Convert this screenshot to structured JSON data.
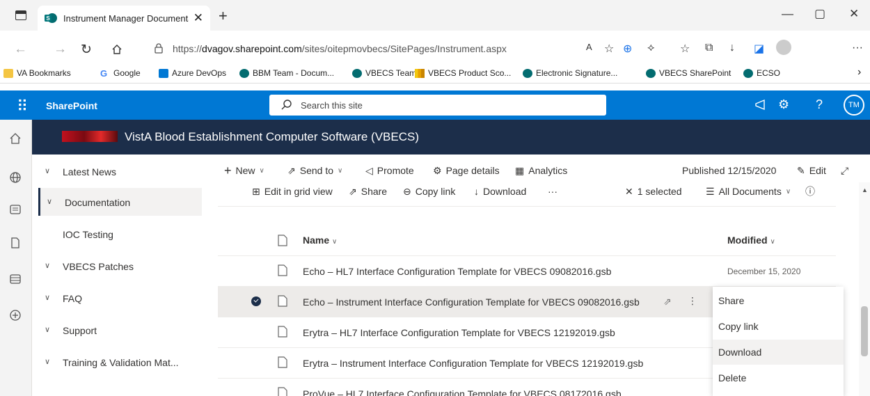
{
  "browser": {
    "tab_title": "Instrument Manager Documenta",
    "tab_close": "✕",
    "new_tab": "+",
    "url_prefix": "https://",
    "url_domain": "dvagov.sharepoint.com",
    "url_path": "/sites/oitepmovbecs/SitePages/Instrument.aspx",
    "window_controls": [
      "—",
      "▢",
      "✕"
    ],
    "read_aloud": "A",
    "menu": "···"
  },
  "bookmarks": [
    {
      "label": "VA Bookmarks",
      "icon": "folder-icon"
    },
    {
      "label": "Google",
      "icon": "google-icon"
    },
    {
      "label": "Azure DevOps",
      "icon": "azure-devops-icon"
    },
    {
      "label": "BBM Team - Docum...",
      "icon": "sharepoint-icon"
    },
    {
      "label": "VBECS Team",
      "icon": "sharepoint-icon"
    },
    {
      "label": "VBECS Product Sco...",
      "icon": "powerbi-icon"
    },
    {
      "label": "Electronic Signature...",
      "icon": "sharepoint-icon"
    },
    {
      "label": "VBECS SharePoint",
      "icon": "sharepoint-icon"
    },
    {
      "label": "ECSO",
      "icon": "sharepoint-icon"
    }
  ],
  "suitebar": {
    "app_name": "SharePoint",
    "search_placeholder": "Search this site",
    "avatar_initials": "TM",
    "help": "?"
  },
  "site": {
    "title": "VistA Blood Establishment Computer Software (VBECS)"
  },
  "leftnav": [
    {
      "label": "Latest News",
      "chevron": true
    },
    {
      "label": "Documentation",
      "chevron": true,
      "active": true
    },
    {
      "label": "IOC Testing",
      "chevron": false
    },
    {
      "label": "VBECS Patches",
      "chevron": true
    },
    {
      "label": "FAQ",
      "chevron": true
    },
    {
      "label": "Support",
      "chevron": true
    },
    {
      "label": "Training & Validation Mat...",
      "chevron": true
    }
  ],
  "commandbar": {
    "new": "New",
    "send_to": "Send to",
    "promote": "Promote",
    "page_details": "Page details",
    "analytics": "Analytics",
    "published": "Published 12/15/2020",
    "edit": "Edit"
  },
  "listbar": {
    "edit_grid": "Edit in grid view",
    "share": "Share",
    "copy_link": "Copy link",
    "download": "Download",
    "more": "···",
    "selected": "1 selected",
    "view": "All Documents"
  },
  "list": {
    "col_name": "Name",
    "col_modified": "Modified",
    "rows": [
      {
        "name": "Echo – HL7 Interface Configuration Template for VBECS 09082016.gsb",
        "modified": "December 15, 2020",
        "selected": false
      },
      {
        "name": "Echo – Instrument Interface Configuration Template for VBECS 09082016.gsb",
        "modified": "",
        "selected": true
      },
      {
        "name": "Erytra – HL7 Interface Configuration Template for VBECS 12192019.gsb",
        "modified": "",
        "selected": false
      },
      {
        "name": "Erytra – Instrument Interface Configuration Template for VBECS 12192019.gsb",
        "modified": "",
        "selected": false
      },
      {
        "name": "ProVue – HL7 Interface Configuration Template for VBECS 08172016.gsb",
        "modified": "",
        "selected": false
      }
    ]
  },
  "context_menu": [
    {
      "label": "Share"
    },
    {
      "label": "Copy link"
    },
    {
      "label": "Download",
      "hover": true
    },
    {
      "label": "Delete"
    }
  ]
}
